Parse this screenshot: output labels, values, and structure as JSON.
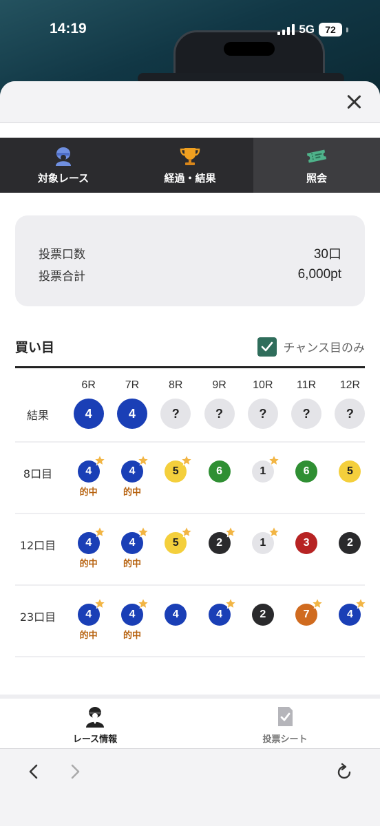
{
  "status_bar": {
    "time": "14:19",
    "network": "5G",
    "battery": "72"
  },
  "tabs": [
    {
      "label": "対象レース",
      "icon": "jockey-icon"
    },
    {
      "label": "経過・結果",
      "icon": "trophy-icon"
    },
    {
      "label": "照会",
      "icon": "ticket-icon",
      "active": true
    }
  ],
  "summary": {
    "count_label": "投票口数",
    "count_value": "30口",
    "total_label": "投票合計",
    "total_value": "6,000pt"
  },
  "bets": {
    "title": "買い目",
    "chance_label": "チャンス目のみ",
    "chance_checked": true,
    "races": [
      "6R",
      "7R",
      "8R",
      "9R",
      "10R",
      "11R",
      "12R"
    ],
    "result_label": "結果",
    "results": [
      "4",
      "4",
      "?",
      "?",
      "?",
      "?",
      "?"
    ],
    "hit_text": "的中",
    "rows": [
      {
        "label": "8口目",
        "picks": [
          {
            "n": "4",
            "color": "blue",
            "star": true,
            "hit": true
          },
          {
            "n": "4",
            "color": "blue",
            "star": true,
            "hit": true
          },
          {
            "n": "5",
            "color": "yellow",
            "star": true,
            "hit": false
          },
          {
            "n": "6",
            "color": "green",
            "star": false,
            "hit": false
          },
          {
            "n": "1",
            "color": "white",
            "star": true,
            "hit": false
          },
          {
            "n": "6",
            "color": "green",
            "star": false,
            "hit": false
          },
          {
            "n": "5",
            "color": "yellow",
            "star": false,
            "hit": false
          }
        ]
      },
      {
        "label": "12口目",
        "picks": [
          {
            "n": "4",
            "color": "blue",
            "star": true,
            "hit": true
          },
          {
            "n": "4",
            "color": "blue",
            "star": true,
            "hit": true
          },
          {
            "n": "5",
            "color": "yellow",
            "star": true,
            "hit": false
          },
          {
            "n": "2",
            "color": "black",
            "star": true,
            "hit": false
          },
          {
            "n": "1",
            "color": "white",
            "star": true,
            "hit": false
          },
          {
            "n": "3",
            "color": "red",
            "star": false,
            "hit": false
          },
          {
            "n": "2",
            "color": "black",
            "star": false,
            "hit": false
          }
        ]
      },
      {
        "label": "23口目",
        "picks": [
          {
            "n": "4",
            "color": "blue",
            "star": true,
            "hit": true
          },
          {
            "n": "4",
            "color": "blue",
            "star": true,
            "hit": true
          },
          {
            "n": "4",
            "color": "blue",
            "star": false,
            "hit": false
          },
          {
            "n": "4",
            "color": "blue",
            "star": true,
            "hit": false
          },
          {
            "n": "2",
            "color": "black",
            "star": false,
            "hit": false
          },
          {
            "n": "7",
            "color": "orange",
            "star": true,
            "hit": false
          },
          {
            "n": "4",
            "color": "blue",
            "star": true,
            "hit": false
          }
        ]
      }
    ]
  },
  "bottom_nav": [
    {
      "label": "レース情報",
      "icon": "race-info-icon",
      "active": true
    },
    {
      "label": "投票シート",
      "icon": "vote-sheet-icon",
      "active": false
    }
  ],
  "colors": {
    "blue": "#1a3fb6",
    "yellow": "#f4cf3c",
    "green": "#2f8f33",
    "white": "#e4e4e8",
    "black": "#2a2a2c",
    "red": "#b72323",
    "orange": "#d06b1f",
    "star": "#f2b544",
    "hit_text": "#b7620f",
    "check": "#2f6d5b"
  }
}
